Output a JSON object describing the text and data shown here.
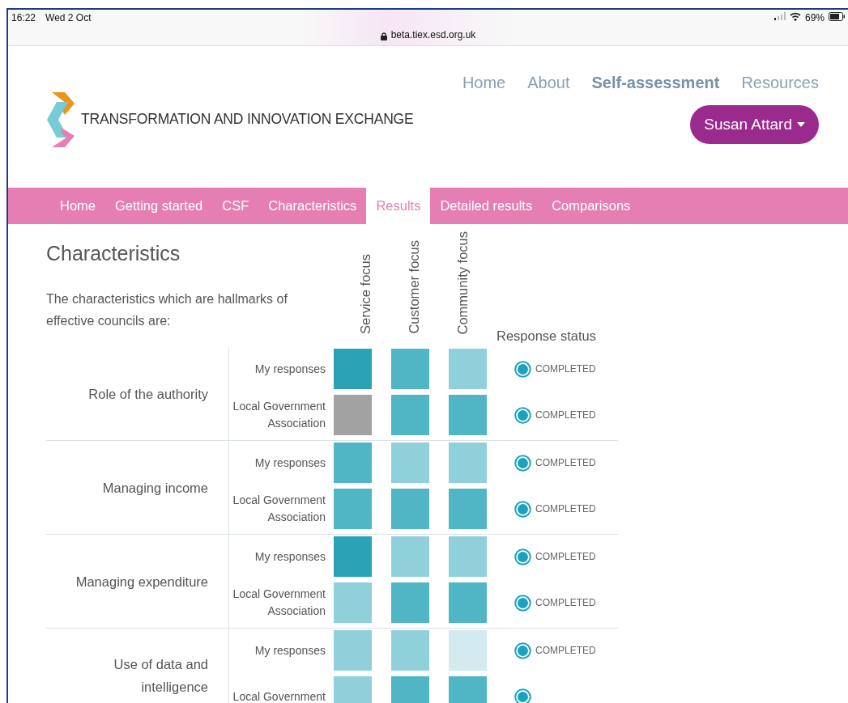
{
  "status_bar": {
    "time": "16:22",
    "date": "Wed 2 Oct",
    "url": "beta.tiex.esd.org.uk",
    "battery": "69%"
  },
  "header": {
    "logo_text": "TRANSFORMATION AND INNOVATION EXCHANGE",
    "nav": [
      {
        "label": "Home",
        "selected": false
      },
      {
        "label": "About",
        "selected": false
      },
      {
        "label": "Self-assessment",
        "selected": true
      },
      {
        "label": "Resources",
        "selected": false
      }
    ],
    "user_button": "Susan Attard"
  },
  "tabs": [
    {
      "label": "Home",
      "selected": false
    },
    {
      "label": "Getting started",
      "selected": false
    },
    {
      "label": "CSF",
      "selected": false
    },
    {
      "label": "Characteristics",
      "selected": false
    },
    {
      "label": "Results",
      "selected": true
    },
    {
      "label": "Detailed results",
      "selected": false
    },
    {
      "label": "Comparisons",
      "selected": false
    }
  ],
  "title": "Characteristics",
  "intro": "The characteristics which are hallmarks of effective councils are:",
  "columns": [
    "Service focus",
    "Customer focus",
    "Community focus"
  ],
  "status_heading": "Response status",
  "groups": [
    {
      "name": "Role of the authority",
      "rows": [
        {
          "respondent": "My responses",
          "cells": [
            {
              "color": "#2ba2b6"
            },
            {
              "color": "#50b5c5"
            },
            {
              "color": "#8fd0db"
            }
          ],
          "status": "COMPLETED"
        },
        {
          "respondent": "Local Government Association",
          "cells": [
            {
              "color": "#a2a2a2"
            },
            {
              "color": "#50b5c5"
            },
            {
              "color": "#50b5c5"
            }
          ],
          "status": "COMPLETED"
        }
      ]
    },
    {
      "name": "Managing income",
      "rows": [
        {
          "respondent": "My responses",
          "cells": [
            {
              "color": "#50b5c5"
            },
            {
              "color": "#8fd0db"
            },
            {
              "color": "#8fd0db"
            }
          ],
          "status": "COMPLETED"
        },
        {
          "respondent": "Local Government Association",
          "cells": [
            {
              "color": "#50b5c5"
            },
            {
              "color": "#50b5c5"
            },
            {
              "color": "#50b5c5"
            }
          ],
          "status": "COMPLETED"
        }
      ]
    },
    {
      "name": "Managing expenditure",
      "rows": [
        {
          "respondent": "My responses",
          "cells": [
            {
              "color": "#2ba2b6"
            },
            {
              "color": "#8fd0db"
            },
            {
              "color": "#8fd0db"
            }
          ],
          "status": "COMPLETED"
        },
        {
          "respondent": "Local Government Association",
          "cells": [
            {
              "color": "#8fd0db"
            },
            {
              "color": "#50b5c5"
            },
            {
              "color": "#50b5c5"
            }
          ],
          "status": "COMPLETED"
        }
      ]
    },
    {
      "name": "Use of data and intelligence",
      "rows": [
        {
          "respondent": "My responses",
          "cells": [
            {
              "color": "#8fd0db"
            },
            {
              "color": "#8fd0db"
            },
            {
              "color": "#d3ebf0"
            }
          ],
          "status": "COMPLETED"
        },
        {
          "respondent": "Local Government",
          "cells": [
            {
              "color": "#8fd0db"
            },
            {
              "color": "#50b5c5"
            },
            {
              "color": "#50b5c5"
            }
          ]
        }
      ]
    }
  ]
}
